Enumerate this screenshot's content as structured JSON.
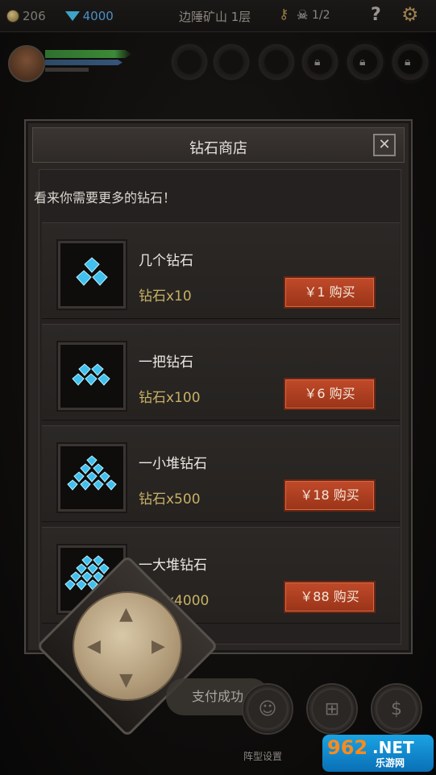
{
  "topbar": {
    "gold": "206",
    "diamonds": "4000",
    "location": "边陲矿山 1层",
    "kills": "1/2",
    "help": "?"
  },
  "dialog": {
    "title": "钻石商店",
    "close": "✕",
    "subtitle": "看来你需要更多的钻石！",
    "items": [
      {
        "name": "几个钻石",
        "amount": "钻石x10",
        "price": "￥1  购买"
      },
      {
        "name": "一把钻石",
        "amount": "钻石x100",
        "price": "￥6  购买"
      },
      {
        "name": "一小堆钻石",
        "amount": "钻石x500",
        "price": "￥18 购买"
      },
      {
        "name": "一大堆钻石",
        "amount": "钻石x4000",
        "price": "￥88 购买"
      }
    ]
  },
  "toast": "支付成功",
  "bottom": {
    "formation_label": "阵型设置"
  },
  "watermark": {
    "number": "962",
    "net": ".NET",
    "sub": "乐游网"
  }
}
